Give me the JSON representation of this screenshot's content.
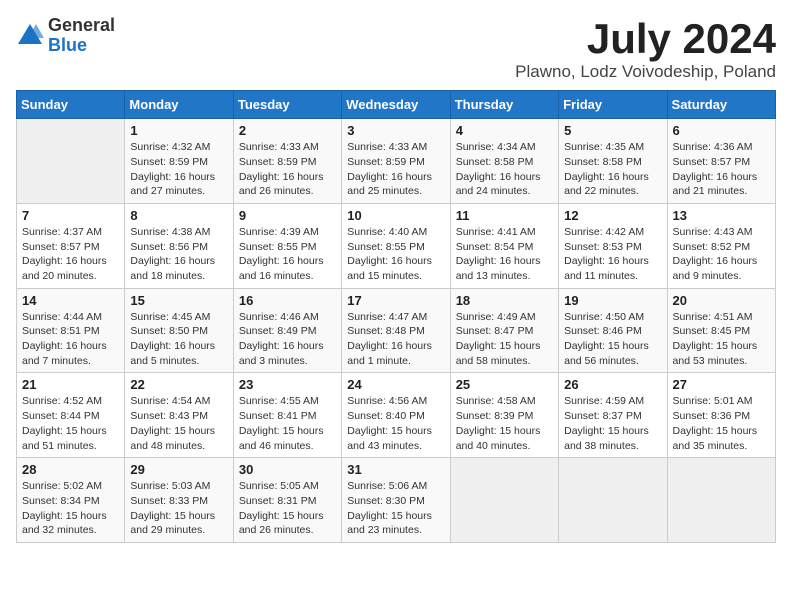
{
  "header": {
    "logo_general": "General",
    "logo_blue": "Blue",
    "month": "July 2024",
    "location": "Plawno, Lodz Voivodeship, Poland"
  },
  "days_of_week": [
    "Sunday",
    "Monday",
    "Tuesday",
    "Wednesday",
    "Thursday",
    "Friday",
    "Saturday"
  ],
  "weeks": [
    [
      {
        "day": "",
        "info": ""
      },
      {
        "day": "1",
        "info": "Sunrise: 4:32 AM\nSunset: 8:59 PM\nDaylight: 16 hours and 27 minutes."
      },
      {
        "day": "2",
        "info": "Sunrise: 4:33 AM\nSunset: 8:59 PM\nDaylight: 16 hours and 26 minutes."
      },
      {
        "day": "3",
        "info": "Sunrise: 4:33 AM\nSunset: 8:59 PM\nDaylight: 16 hours and 25 minutes."
      },
      {
        "day": "4",
        "info": "Sunrise: 4:34 AM\nSunset: 8:58 PM\nDaylight: 16 hours and 24 minutes."
      },
      {
        "day": "5",
        "info": "Sunrise: 4:35 AM\nSunset: 8:58 PM\nDaylight: 16 hours and 22 minutes."
      },
      {
        "day": "6",
        "info": "Sunrise: 4:36 AM\nSunset: 8:57 PM\nDaylight: 16 hours and 21 minutes."
      }
    ],
    [
      {
        "day": "7",
        "info": "Sunrise: 4:37 AM\nSunset: 8:57 PM\nDaylight: 16 hours and 20 minutes."
      },
      {
        "day": "8",
        "info": "Sunrise: 4:38 AM\nSunset: 8:56 PM\nDaylight: 16 hours and 18 minutes."
      },
      {
        "day": "9",
        "info": "Sunrise: 4:39 AM\nSunset: 8:55 PM\nDaylight: 16 hours and 16 minutes."
      },
      {
        "day": "10",
        "info": "Sunrise: 4:40 AM\nSunset: 8:55 PM\nDaylight: 16 hours and 15 minutes."
      },
      {
        "day": "11",
        "info": "Sunrise: 4:41 AM\nSunset: 8:54 PM\nDaylight: 16 hours and 13 minutes."
      },
      {
        "day": "12",
        "info": "Sunrise: 4:42 AM\nSunset: 8:53 PM\nDaylight: 16 hours and 11 minutes."
      },
      {
        "day": "13",
        "info": "Sunrise: 4:43 AM\nSunset: 8:52 PM\nDaylight: 16 hours and 9 minutes."
      }
    ],
    [
      {
        "day": "14",
        "info": "Sunrise: 4:44 AM\nSunset: 8:51 PM\nDaylight: 16 hours and 7 minutes."
      },
      {
        "day": "15",
        "info": "Sunrise: 4:45 AM\nSunset: 8:50 PM\nDaylight: 16 hours and 5 minutes."
      },
      {
        "day": "16",
        "info": "Sunrise: 4:46 AM\nSunset: 8:49 PM\nDaylight: 16 hours and 3 minutes."
      },
      {
        "day": "17",
        "info": "Sunrise: 4:47 AM\nSunset: 8:48 PM\nDaylight: 16 hours and 1 minute."
      },
      {
        "day": "18",
        "info": "Sunrise: 4:49 AM\nSunset: 8:47 PM\nDaylight: 15 hours and 58 minutes."
      },
      {
        "day": "19",
        "info": "Sunrise: 4:50 AM\nSunset: 8:46 PM\nDaylight: 15 hours and 56 minutes."
      },
      {
        "day": "20",
        "info": "Sunrise: 4:51 AM\nSunset: 8:45 PM\nDaylight: 15 hours and 53 minutes."
      }
    ],
    [
      {
        "day": "21",
        "info": "Sunrise: 4:52 AM\nSunset: 8:44 PM\nDaylight: 15 hours and 51 minutes."
      },
      {
        "day": "22",
        "info": "Sunrise: 4:54 AM\nSunset: 8:43 PM\nDaylight: 15 hours and 48 minutes."
      },
      {
        "day": "23",
        "info": "Sunrise: 4:55 AM\nSunset: 8:41 PM\nDaylight: 15 hours and 46 minutes."
      },
      {
        "day": "24",
        "info": "Sunrise: 4:56 AM\nSunset: 8:40 PM\nDaylight: 15 hours and 43 minutes."
      },
      {
        "day": "25",
        "info": "Sunrise: 4:58 AM\nSunset: 8:39 PM\nDaylight: 15 hours and 40 minutes."
      },
      {
        "day": "26",
        "info": "Sunrise: 4:59 AM\nSunset: 8:37 PM\nDaylight: 15 hours and 38 minutes."
      },
      {
        "day": "27",
        "info": "Sunrise: 5:01 AM\nSunset: 8:36 PM\nDaylight: 15 hours and 35 minutes."
      }
    ],
    [
      {
        "day": "28",
        "info": "Sunrise: 5:02 AM\nSunset: 8:34 PM\nDaylight: 15 hours and 32 minutes."
      },
      {
        "day": "29",
        "info": "Sunrise: 5:03 AM\nSunset: 8:33 PM\nDaylight: 15 hours and 29 minutes."
      },
      {
        "day": "30",
        "info": "Sunrise: 5:05 AM\nSunset: 8:31 PM\nDaylight: 15 hours and 26 minutes."
      },
      {
        "day": "31",
        "info": "Sunrise: 5:06 AM\nSunset: 8:30 PM\nDaylight: 15 hours and 23 minutes."
      },
      {
        "day": "",
        "info": ""
      },
      {
        "day": "",
        "info": ""
      },
      {
        "day": "",
        "info": ""
      }
    ]
  ]
}
